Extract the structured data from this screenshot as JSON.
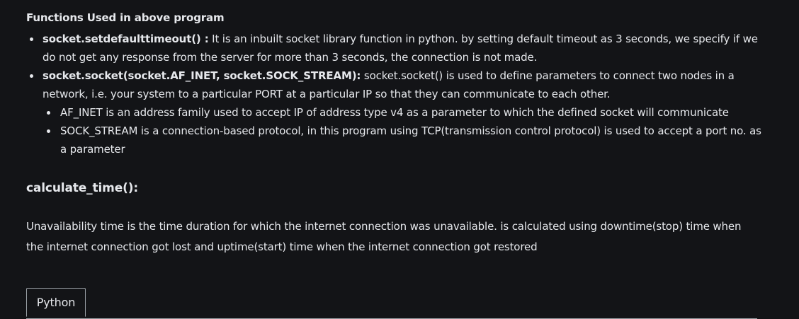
{
  "heading": "Functions Used in above program",
  "bullets": [
    {
      "term": "socket.setdefaulttimeout() :",
      "text": " It is an inbuilt socket library function in python. by setting default timeout as 3 seconds, we specify if we do not get any response from the server for more than 3 seconds, the connection is not made."
    },
    {
      "term": "socket.socket(socket.AF_INET, socket.SOCK_STREAM):",
      "text": " socket.socket() is used to define parameters to connect two nodes in a network, i.e. your system to a particular PORT at a particular IP so that they can communicate to each other.",
      "sub_items": [
        "AF_INET is an address family used to accept IP of address type v4 as a parameter to which the defined socket will communicate",
        "SOCK_STREAM is a connection-based protocol, in this program using TCP(transmission control protocol) is used to accept a port no. as a parameter"
      ]
    }
  ],
  "subheading": "calculate_time():",
  "paragraph": "Unavailability time is the time duration for which the internet connection was unavailable. is calculated using downtime(stop) time when the internet connection got lost and uptime(start) time when the internet connection got restored",
  "code_tabs": [
    {
      "label": "Python",
      "active": true
    }
  ],
  "colors": {
    "background": "#131417",
    "text": "#e6e8ec",
    "border": "#9aa0a6"
  }
}
